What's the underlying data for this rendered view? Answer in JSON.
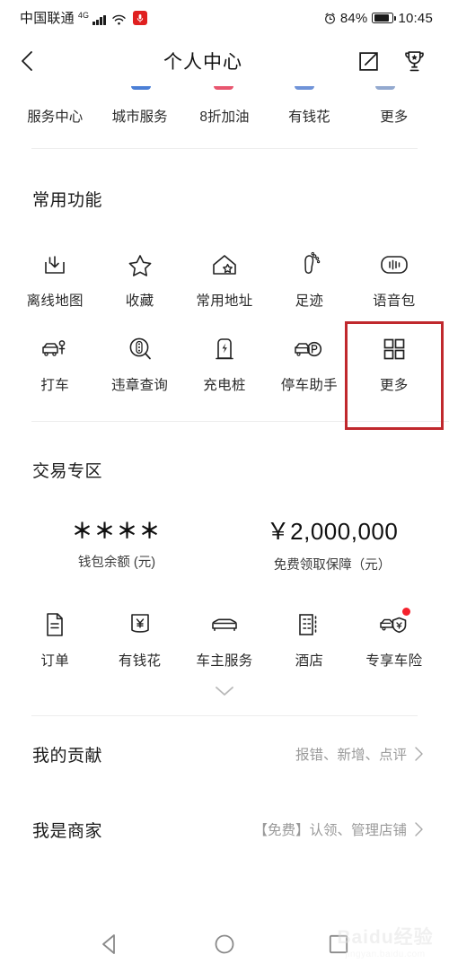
{
  "status_bar": {
    "carrier": "中国联通",
    "network": "4G",
    "network_plus": "+",
    "battery_percent": "84%",
    "time": "10:45",
    "icons": [
      "signal-bars-icon",
      "wifi-icon",
      "microphone-icon",
      "alarm-clock-icon",
      "battery-icon"
    ]
  },
  "header": {
    "title": "个人中心",
    "back_icon": "chevron-left-icon",
    "edit_icon": "edit-square-icon",
    "trophy_icon": "trophy-icon"
  },
  "top_row": {
    "items": [
      {
        "label": "服务中心",
        "accent": ""
      },
      {
        "label": "城市服务",
        "accent": "#4b7fd6"
      },
      {
        "label": "8折加油",
        "accent": "#e8566f"
      },
      {
        "label": "有钱花",
        "accent": "#4b7fd6"
      },
      {
        "label": "更多",
        "accent": "#8fa7cf"
      }
    ]
  },
  "common_functions": {
    "title": "常用功能",
    "row1": [
      {
        "label": "离线地图",
        "icon": "download-map-icon"
      },
      {
        "label": "收藏",
        "icon": "star-icon"
      },
      {
        "label": "常用地址",
        "icon": "home-star-icon"
      },
      {
        "label": "足迹",
        "icon": "footprint-icon"
      },
      {
        "label": "语音包",
        "icon": "voice-package-icon"
      }
    ],
    "row2": [
      {
        "label": "打车",
        "icon": "taxi-icon"
      },
      {
        "label": "违章查询",
        "icon": "traffic-violation-search-icon"
      },
      {
        "label": "充电桩",
        "icon": "charging-pile-icon"
      },
      {
        "label": "停车助手",
        "icon": "parking-assistant-icon"
      },
      {
        "label": "更多",
        "icon": "grid-more-icon"
      }
    ]
  },
  "trade_zone": {
    "title": "交易专区",
    "stats": [
      {
        "value": "＊＊＊＊",
        "caption": "钱包余额 (元)"
      },
      {
        "value": "￥2,000,000",
        "caption": "免费领取保障（元）"
      }
    ],
    "items": [
      {
        "label": "订单",
        "icon": "document-icon",
        "badge": false
      },
      {
        "label": "有钱花",
        "icon": "yuan-wallet-icon",
        "badge": false
      },
      {
        "label": "车主服务",
        "icon": "car-icon",
        "badge": false
      },
      {
        "label": "酒店",
        "icon": "hotel-building-icon",
        "badge": false
      },
      {
        "label": "专享车险",
        "icon": "car-insurance-icon",
        "badge": true
      }
    ],
    "expand_icon": "chevron-down-icon"
  },
  "list_rows": [
    {
      "label": "我的贡献",
      "value": "报错、新增、点评",
      "chevron": "chevron-right-icon"
    },
    {
      "label": "我是商家",
      "value": "【免费】认领、管理店铺",
      "chevron": "chevron-right-icon"
    }
  ],
  "highlight": {
    "color": "#c0282d",
    "target": "更多"
  },
  "nav_bar": {
    "back_icon": "triangle-back-icon",
    "home_icon": "circle-home-icon",
    "recents_icon": "square-recents-icon"
  },
  "watermark": {
    "main": "Baidu经验",
    "sub": "jingyan.baidu.com"
  }
}
